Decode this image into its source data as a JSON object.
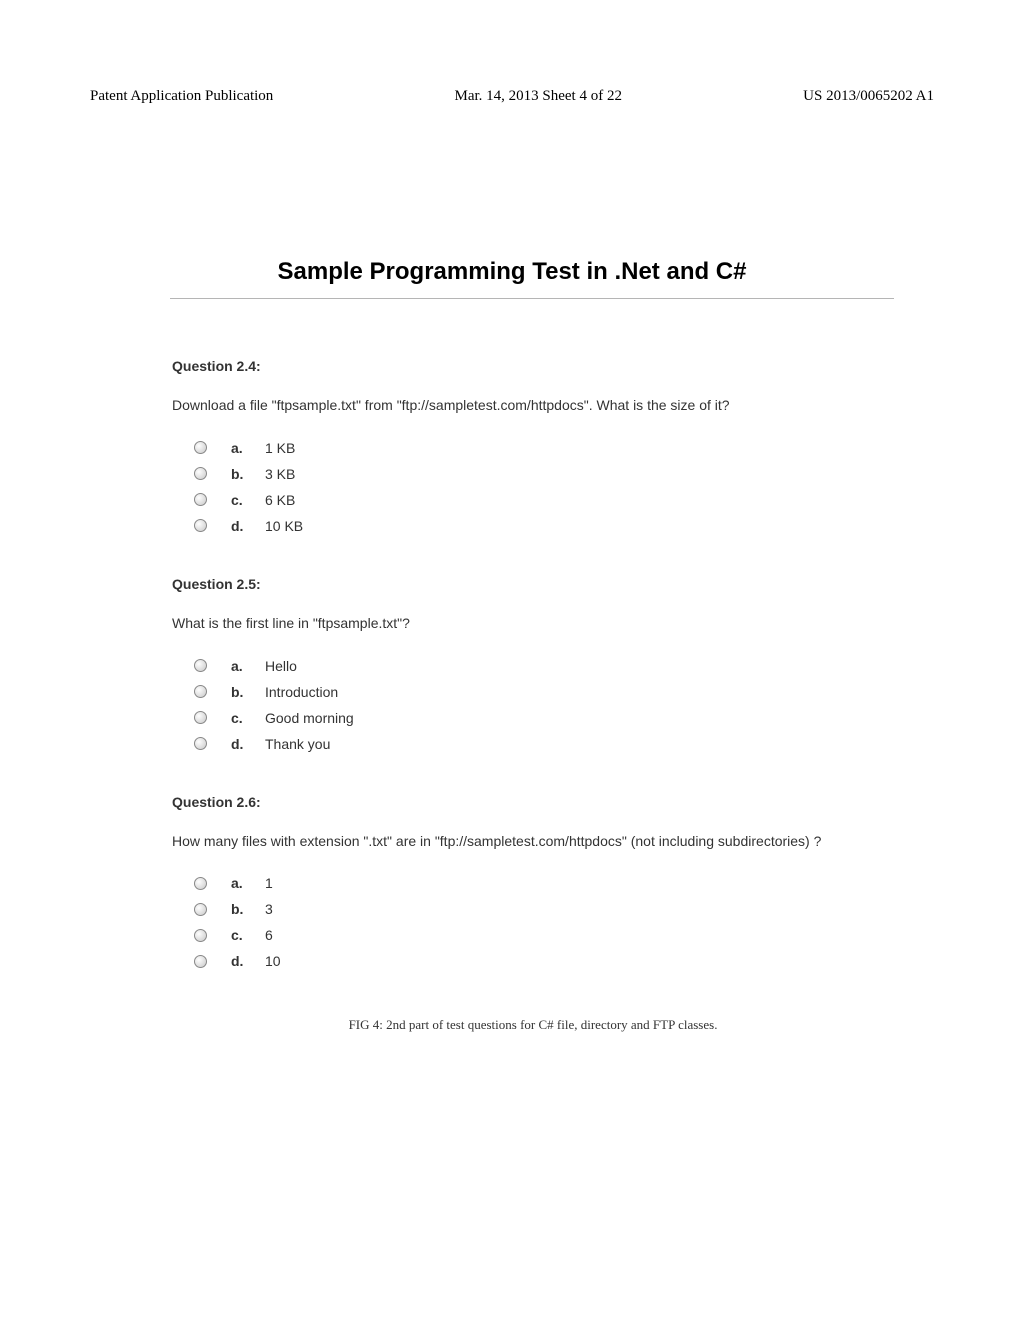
{
  "header": {
    "left": "Patent Application Publication",
    "center": "Mar. 14, 2013  Sheet 4 of 22",
    "right": "US 2013/0065202 A1"
  },
  "title": "Sample Programming Test in .Net and C#",
  "questions": [
    {
      "heading": "Question 2.4:",
      "text": "Download a file \"ftpsample.txt\" from \"ftp://sampletest.com/httpdocs\". What is the size of it?",
      "options": [
        {
          "letter": "a.",
          "text": "1 KB"
        },
        {
          "letter": "b.",
          "text": "3 KB"
        },
        {
          "letter": "c.",
          "text": "6 KB"
        },
        {
          "letter": "d.",
          "text": "10 KB"
        }
      ]
    },
    {
      "heading": "Question 2.5:",
      "text": "What is the first line in \"ftpsample.txt\"?",
      "options": [
        {
          "letter": "a.",
          "text": "Hello"
        },
        {
          "letter": "b.",
          "text": "Introduction"
        },
        {
          "letter": "c.",
          "text": "Good morning"
        },
        {
          "letter": "d.",
          "text": "Thank you"
        }
      ]
    },
    {
      "heading": "Question 2.6:",
      "text": "How many files with extension \".txt\" are in \"ftp://sampletest.com/httpdocs\" (not including subdirectories) ?",
      "options": [
        {
          "letter": "a.",
          "text": "1"
        },
        {
          "letter": "b.",
          "text": "3"
        },
        {
          "letter": "c.",
          "text": "6"
        },
        {
          "letter": "d.",
          "text": "10"
        }
      ]
    }
  ],
  "caption": "FIG 4: 2nd part of test questions for C# file, directory and FTP classes."
}
